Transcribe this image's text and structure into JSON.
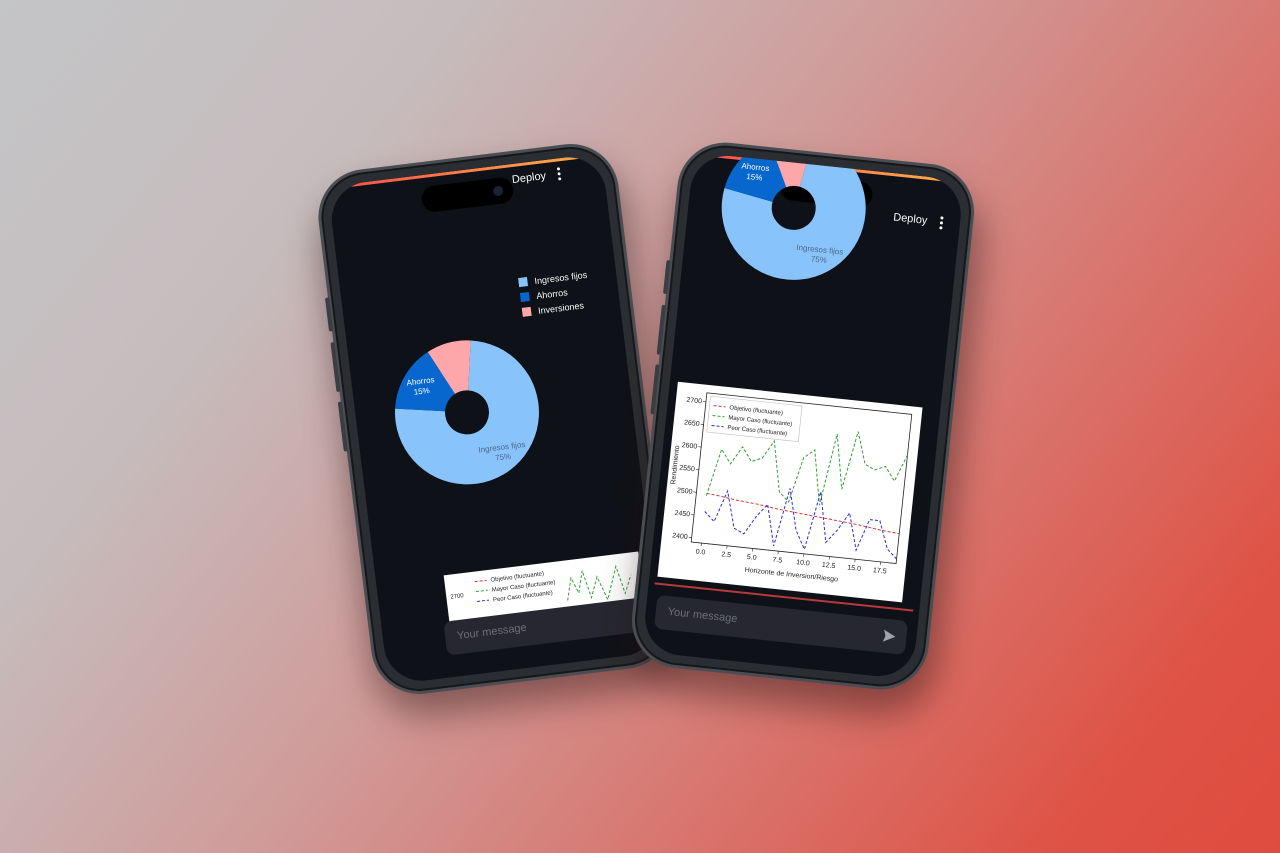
{
  "app": {
    "deploy_label": "Deploy",
    "menu_icon": "kebab-menu-icon",
    "accent_colors": [
      "#ff4b4b",
      "#fdb24b"
    ],
    "background": "#0e1117"
  },
  "chat": {
    "placeholder": "Your message",
    "send_icon": "send-icon"
  },
  "pie": {
    "legend": [
      {
        "label": "Ingresos fijos",
        "color": "#89c3fb"
      },
      {
        "label": "Ahorros",
        "color": "#0867cf"
      },
      {
        "label": "Inversiones",
        "color": "#fda7ab"
      }
    ],
    "slices": [
      {
        "name": "Ingresos fijos",
        "value": 75,
        "label": "Ingresos fijos",
        "pct": "75%"
      },
      {
        "name": "Ahorros",
        "value": 15,
        "label": "Ahorros",
        "pct": "15%"
      },
      {
        "name": "Inversiones",
        "value": 10,
        "label": "",
        "pct": ""
      }
    ]
  },
  "line_chart": {
    "legend": [
      {
        "label": "Objetivo (fluctuante)",
        "color": "#e03030",
        "dash": "4,3"
      },
      {
        "label": "Mayor Caso (fluctuante)",
        "color": "#2ea02e",
        "dash": "4,3"
      },
      {
        "label": "Peor Caso (fluctuante)",
        "color": "#2b2bd6",
        "dash": "4,3"
      }
    ],
    "ylabel": "Rendimiento",
    "xlabel": "Horizonte de Inversion/Riesgo",
    "yticks": [
      "2400",
      "2450",
      "2500",
      "2550",
      "2600",
      "2650",
      "2700"
    ],
    "xticks": [
      "0.0",
      "2.5",
      "5.0",
      "7.5",
      "10.0",
      "12.5",
      "15.0",
      "17.5"
    ],
    "visible_ytick_left_phone": "2700"
  },
  "chart_data": [
    {
      "type": "pie",
      "categories": [
        "Ingresos fijos",
        "Ahorros",
        "Inversiones"
      ],
      "values": [
        75,
        15,
        10
      ],
      "colors": [
        "#89c3fb",
        "#0867cf",
        "#fda7ab"
      ],
      "legend_position": "top-right"
    },
    {
      "type": "line",
      "x": [
        0,
        1,
        2,
        3,
        4,
        5,
        6,
        7,
        8,
        9,
        10,
        11,
        12,
        13,
        14,
        15,
        16,
        17,
        18,
        19
      ],
      "series": [
        {
          "name": "Objetivo (fluctuante)",
          "values": [
            2500,
            2498,
            2495,
            2492,
            2490,
            2488,
            2485,
            2482,
            2480,
            2478,
            2476,
            2474,
            2472,
            2470,
            2468,
            2466,
            2463,
            2460,
            2458,
            2456
          ]
        },
        {
          "name": "Mayor Caso (fluctuante)",
          "values": [
            2495,
            2600,
            2570,
            2610,
            2580,
            2590,
            2630,
            2520,
            2500,
            2600,
            2620,
            2500,
            2660,
            2540,
            2670,
            2600,
            2590,
            2600,
            2570,
            2630
          ]
        },
        {
          "name": "Peor Caso (fluctuante)",
          "values": [
            2460,
            2440,
            2510,
            2430,
            2420,
            2460,
            2490,
            2400,
            2530,
            2440,
            2400,
            2530,
            2420,
            2450,
            2490,
            2410,
            2480,
            2480,
            2420,
            2400
          ]
        }
      ],
      "xlabel": "Horizonte de Inversion/Riesgo",
      "ylabel": "Rendimiento",
      "xlim": [
        -1,
        19
      ],
      "ylim": [
        2390,
        2720
      ],
      "grid": false,
      "legend_position": "top-left"
    }
  ]
}
